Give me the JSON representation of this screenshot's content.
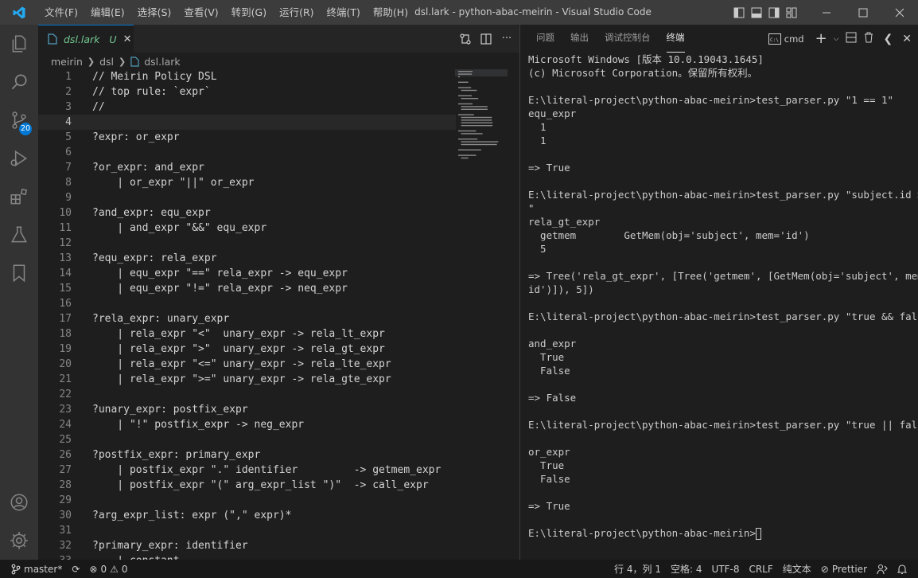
{
  "window": {
    "title": "dsl.lark - python-abac-meirin - Visual Studio Code",
    "menu": [
      "文件(F)",
      "编辑(E)",
      "选择(S)",
      "查看(V)",
      "转到(G)",
      "运行(R)",
      "终端(T)",
      "帮助(H)"
    ]
  },
  "activity": {
    "scm_badge": "20"
  },
  "editor": {
    "tab": {
      "label": "dsl.lark",
      "status": "U"
    },
    "breadcrumb": [
      "meirin",
      "dsl",
      "dsl.lark"
    ],
    "current_line": 4,
    "lines": [
      {
        "n": "1",
        "t": "// Meirin Policy DSL"
      },
      {
        "n": "2",
        "t": "// top rule: `expr`"
      },
      {
        "n": "3",
        "t": "//"
      },
      {
        "n": "4",
        "t": ""
      },
      {
        "n": "5",
        "t": "?expr: or_expr"
      },
      {
        "n": "6",
        "t": ""
      },
      {
        "n": "7",
        "t": "?or_expr: and_expr"
      },
      {
        "n": "8",
        "t": "    | or_expr \"||\" or_expr"
      },
      {
        "n": "9",
        "t": ""
      },
      {
        "n": "10",
        "t": "?and_expr: equ_expr"
      },
      {
        "n": "11",
        "t": "    | and_expr \"&&\" equ_expr"
      },
      {
        "n": "12",
        "t": ""
      },
      {
        "n": "13",
        "t": "?equ_expr: rela_expr"
      },
      {
        "n": "14",
        "t": "    | equ_expr \"==\" rela_expr -> equ_expr"
      },
      {
        "n": "15",
        "t": "    | equ_expr \"!=\" rela_expr -> neq_expr"
      },
      {
        "n": "16",
        "t": ""
      },
      {
        "n": "17",
        "t": "?rela_expr: unary_expr"
      },
      {
        "n": "18",
        "t": "    | rela_expr \"<\"  unary_expr -> rela_lt_expr"
      },
      {
        "n": "19",
        "t": "    | rela_expr \">\"  unary_expr -> rela_gt_expr"
      },
      {
        "n": "20",
        "t": "    | rela_expr \"<=\" unary_expr -> rela_lte_expr"
      },
      {
        "n": "21",
        "t": "    | rela_expr \">=\" unary_expr -> rela_gte_expr"
      },
      {
        "n": "22",
        "t": ""
      },
      {
        "n": "23",
        "t": "?unary_expr: postfix_expr"
      },
      {
        "n": "24",
        "t": "    | \"!\" postfix_expr -> neg_expr"
      },
      {
        "n": "25",
        "t": ""
      },
      {
        "n": "26",
        "t": "?postfix_expr: primary_expr"
      },
      {
        "n": "27",
        "t": "    | postfix_expr \".\" identifier         -> getmem_expr"
      },
      {
        "n": "28",
        "t": "    | postfix_expr \"(\" arg_expr_list \")\"  -> call_expr"
      },
      {
        "n": "29",
        "t": ""
      },
      {
        "n": "30",
        "t": "?arg_expr_list: expr (\",\" expr)*"
      },
      {
        "n": "31",
        "t": ""
      },
      {
        "n": "32",
        "t": "?primary_expr: identifier"
      },
      {
        "n": "33",
        "t": "    | constant"
      }
    ]
  },
  "panel": {
    "tabs": [
      "问题",
      "输出",
      "调试控制台",
      "终端"
    ],
    "active_tab": 3,
    "terminal_name": "cmd",
    "terminal_lines": [
      "Microsoft Windows [版本 10.0.19043.1645]",
      "(c) Microsoft Corporation。保留所有权利。",
      "",
      "E:\\literal-project\\python-abac-meirin>test_parser.py \"1 == 1\"",
      "equ_expr",
      "  1",
      "  1",
      "",
      "=> True",
      "",
      "E:\\literal-project\\python-abac-meirin>test_parser.py \"subject.id > 5",
      "\"",
      "rela_gt_expr",
      "  getmem        GetMem(obj='subject', mem='id')",
      "  5",
      "",
      "=> Tree('rela_gt_expr', [Tree('getmem', [GetMem(obj='subject', mem='",
      "id')]), 5])",
      "",
      "E:\\literal-project\\python-abac-meirin>test_parser.py \"true && false\"",
      "",
      "and_expr",
      "  True",
      "  False",
      "",
      "=> False",
      "",
      "E:\\literal-project\\python-abac-meirin>test_parser.py \"true || false\"",
      "",
      "or_expr",
      "  True",
      "  False",
      "",
      "=> True",
      ""
    ],
    "prompt": "E:\\literal-project\\python-abac-meirin>"
  },
  "status": {
    "branch": "master*",
    "errors": "0",
    "warnings": "0",
    "position": "行 4，列 1",
    "indent": "空格: 4",
    "encoding": "UTF-8",
    "eol": "CRLF",
    "language": "纯文本",
    "formatter": "Prettier"
  },
  "colors": {
    "accent": "#0078d4",
    "untracked": "#73c991",
    "background": "#1e1e1e"
  }
}
